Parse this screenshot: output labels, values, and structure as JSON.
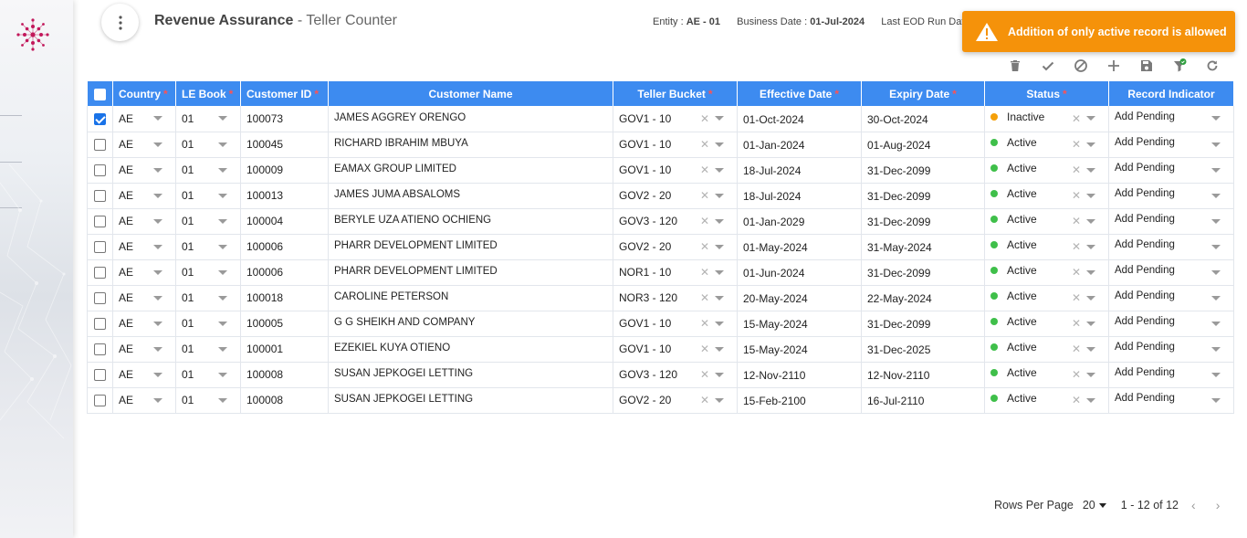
{
  "header": {
    "title": "Revenue Assurance",
    "subtitle": "Teller Counter",
    "entity_label": "Entity :",
    "entity_value": "AE - 01",
    "business_date_label": "Business Date :",
    "business_date_value": "01-Jul-2024",
    "eod_label": "Last EOD Run Date"
  },
  "toast": {
    "message": "Addition of only active record is allowed",
    "color": "#f5920a"
  },
  "toolbar": [
    {
      "name": "delete-icon"
    },
    {
      "name": "check-icon"
    },
    {
      "name": "block-icon"
    },
    {
      "name": "add-icon"
    },
    {
      "name": "save-icon"
    },
    {
      "name": "filter-icon"
    },
    {
      "name": "refresh-icon"
    }
  ],
  "table": {
    "header_color": "#3d8bf0",
    "columns": [
      {
        "label": "Country",
        "required": true
      },
      {
        "label": "LE Book",
        "required": true
      },
      {
        "label": "Customer ID",
        "required": true
      },
      {
        "label": "Customer Name",
        "required": false
      },
      {
        "label": "Teller Bucket",
        "required": true
      },
      {
        "label": "Effective Date",
        "required": true
      },
      {
        "label": "Expiry Date",
        "required": true
      },
      {
        "label": "Status",
        "required": true
      },
      {
        "label": "Record Indicator",
        "required": false
      }
    ],
    "required_mark": "*",
    "rows": [
      {
        "checked": true,
        "country": "AE",
        "le_book": "01",
        "customer_id": "100073",
        "customer_name": "JAMES AGGREY ORENGO",
        "teller_bucket": "GOV1 - 10",
        "effective_date": "01-Oct-2024",
        "expiry_date": "30-Oct-2024",
        "status": "Inactive",
        "record_indicator": "Add Pending"
      },
      {
        "checked": false,
        "country": "AE",
        "le_book": "01",
        "customer_id": "100045",
        "customer_name": "RICHARD IBRAHIM MBUYA",
        "teller_bucket": "GOV1 - 10",
        "effective_date": "01-Jan-2024",
        "expiry_date": "01-Aug-2024",
        "status": "Active",
        "record_indicator": "Add Pending"
      },
      {
        "checked": false,
        "country": "AE",
        "le_book": "01",
        "customer_id": "100009",
        "customer_name": "EAMAX GROUP LIMITED",
        "teller_bucket": "GOV1 - 10",
        "effective_date": "18-Jul-2024",
        "expiry_date": "31-Dec-2099",
        "status": "Active",
        "record_indicator": "Add Pending"
      },
      {
        "checked": false,
        "country": "AE",
        "le_book": "01",
        "customer_id": "100013",
        "customer_name": "JAMES JUMA ABSALOMS",
        "teller_bucket": "GOV2 - 20",
        "effective_date": "18-Jul-2024",
        "expiry_date": "31-Dec-2099",
        "status": "Active",
        "record_indicator": "Add Pending"
      },
      {
        "checked": false,
        "country": "AE",
        "le_book": "01",
        "customer_id": "100004",
        "customer_name": "BERYLE UZA ATIENO OCHIENG",
        "teller_bucket": "GOV3 - 120",
        "effective_date": "01-Jan-2029",
        "expiry_date": "31-Dec-2099",
        "status": "Active",
        "record_indicator": "Add Pending"
      },
      {
        "checked": false,
        "country": "AE",
        "le_book": "01",
        "customer_id": "100006",
        "customer_name": "PHARR DEVELOPMENT LIMITED",
        "teller_bucket": "GOV2 - 20",
        "effective_date": "01-May-2024",
        "expiry_date": "31-May-2024",
        "status": "Active",
        "record_indicator": "Add Pending"
      },
      {
        "checked": false,
        "country": "AE",
        "le_book": "01",
        "customer_id": "100006",
        "customer_name": "PHARR DEVELOPMENT LIMITED",
        "teller_bucket": "NOR1 - 10",
        "effective_date": "01-Jun-2024",
        "expiry_date": "31-Dec-2099",
        "status": "Active",
        "record_indicator": "Add Pending"
      },
      {
        "checked": false,
        "country": "AE",
        "le_book": "01",
        "customer_id": "100018",
        "customer_name": "CAROLINE PETERSON",
        "teller_bucket": "NOR3 - 120",
        "effective_date": "20-May-2024",
        "expiry_date": "22-May-2024",
        "status": "Active",
        "record_indicator": "Add Pending"
      },
      {
        "checked": false,
        "country": "AE",
        "le_book": "01",
        "customer_id": "100005",
        "customer_name": "G G SHEIKH AND COMPANY",
        "teller_bucket": "GOV1 - 10",
        "effective_date": "15-May-2024",
        "expiry_date": "31-Dec-2099",
        "status": "Active",
        "record_indicator": "Add Pending"
      },
      {
        "checked": false,
        "country": "AE",
        "le_book": "01",
        "customer_id": "100001",
        "customer_name": "EZEKIEL KUYA OTIENO",
        "teller_bucket": "GOV1 - 10",
        "effective_date": "15-May-2024",
        "expiry_date": "31-Dec-2025",
        "status": "Active",
        "record_indicator": "Add Pending"
      },
      {
        "checked": false,
        "country": "AE",
        "le_book": "01",
        "customer_id": "100008",
        "customer_name": "SUSAN JEPKOGEI LETTING",
        "teller_bucket": "GOV3 - 120",
        "effective_date": "12-Nov-2110",
        "expiry_date": "12-Nov-2110",
        "status": "Active",
        "record_indicator": "Add Pending"
      },
      {
        "checked": false,
        "country": "AE",
        "le_book": "01",
        "customer_id": "100008",
        "customer_name": "SUSAN JEPKOGEI LETTING",
        "teller_bucket": "GOV2 - 20",
        "effective_date": "15-Feb-2100",
        "expiry_date": "16-Jul-2110",
        "status": "Active",
        "record_indicator": "Add Pending"
      }
    ]
  },
  "pager": {
    "rows_per_page_label": "Rows Per Page",
    "rows_per_page_value": "20",
    "range": "1 - 12 of 12",
    "prev_icon": "‹",
    "next_icon": "›"
  },
  "status_colors": {
    "Active": "#3fbf4a",
    "Inactive": "#f5a00a"
  }
}
